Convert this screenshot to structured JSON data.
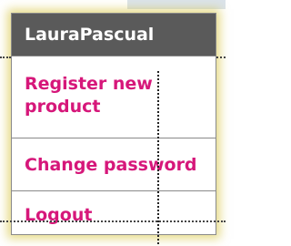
{
  "menu": {
    "user_name": "LauraPascual",
    "items": [
      {
        "label": "Register new product"
      },
      {
        "label": "Change password"
      },
      {
        "label": "Logout"
      }
    ]
  },
  "colors": {
    "header_background": "#5a5a5a",
    "header_text": "#ffffff",
    "item_text": "#d6177a",
    "highlight_glow": "#d2be28"
  }
}
